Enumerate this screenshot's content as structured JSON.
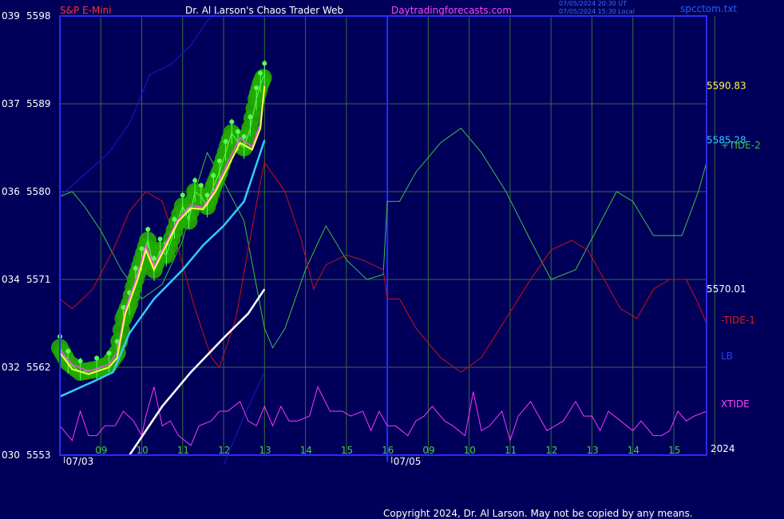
{
  "header": {
    "symbol": "S&P E-Mini",
    "title": "Dr. Al Larson's Chaos Trader Web",
    "site": "Daytradingforecasts.com",
    "timestamp_ut": "07/05/2024 20:30 UT",
    "timestamp_local": "07/05/2024 15:30 Local",
    "file": "spcctom.txt"
  },
  "footer": {
    "copyright": "Copyright 2024, Dr. Al Larson. May not be copied by any means."
  },
  "colors": {
    "background": "#00005a",
    "frame": "#2a2aff",
    "grid": "#3a6b3a",
    "tide1": "#cc1111",
    "tide2": "#3fbf3f",
    "xtide": "#ff33ff",
    "lb": "#1a1acc",
    "price_glow": "#22aa00",
    "price_bars": "#55ff55",
    "avg_yellow": "#ffff44",
    "avg_magenta": "#ff44ff",
    "cyan_line": "#33ccff",
    "white_line": "#ffffff"
  },
  "chart_data": {
    "type": "line",
    "title": "S&P E-Mini",
    "y_axis": {
      "range": [
        5553,
        5598
      ],
      "ticks": [
        5553,
        5562,
        5571,
        5580,
        5589,
        5598
      ],
      "left_codes": [
        "030",
        "032",
        "034",
        "036",
        "037",
        "039"
      ]
    },
    "x_axis": {
      "hour_ticks": [
        {
          "x": 9,
          "label": "09"
        },
        {
          "x": 10,
          "label": "10"
        },
        {
          "x": 11,
          "label": "11"
        },
        {
          "x": 12,
          "label": "12"
        },
        {
          "x": 13,
          "label": "13"
        },
        {
          "x": 14,
          "label": "14"
        },
        {
          "x": 15,
          "label": "15"
        },
        {
          "x": 16,
          "label": "16"
        },
        {
          "x": 17,
          "label": "09"
        },
        {
          "x": 18,
          "label": "10"
        },
        {
          "x": 19,
          "label": "11"
        },
        {
          "x": 20,
          "label": "12"
        },
        {
          "x": 21,
          "label": "13"
        },
        {
          "x": 22,
          "label": "14"
        },
        {
          "x": 23,
          "label": "15"
        },
        {
          "x": 24,
          "label": "16"
        }
      ],
      "dates": [
        {
          "x": 8.5,
          "label": "07/03"
        },
        {
          "x": 16.5,
          "label": "07/05"
        }
      ],
      "day_break_x": 16,
      "corner_label": "2024",
      "range": [
        8.0,
        23.8
      ]
    },
    "right_values": [
      {
        "label": "5590.83",
        "y": 5590.83,
        "color": "#ffff44"
      },
      {
        "label": "5585.28",
        "y": 5585.28,
        "color": "#33ccff"
      },
      {
        "label": "5570.01",
        "y": 5570.01,
        "color": "#ffffff"
      }
    ],
    "legend": [
      {
        "name": "+TIDE-2",
        "color": "#3fbf3f"
      },
      {
        "name": "-TIDE-1",
        "color": "#cc1111"
      },
      {
        "name": "LB",
        "color": "#1a1acc"
      },
      {
        "name": "XTIDE",
        "color": "#ff33ff"
      }
    ],
    "series": [
      {
        "name": "+TIDE-2",
        "values": [
          [
            8.0,
            5579.5
          ],
          [
            8.3,
            5580
          ],
          [
            8.6,
            5578.5
          ],
          [
            9.0,
            5576
          ],
          [
            9.5,
            5572
          ],
          [
            10.0,
            5569
          ],
          [
            10.5,
            5570.5
          ],
          [
            11.0,
            5575
          ],
          [
            11.3,
            5580
          ],
          [
            11.6,
            5584
          ],
          [
            12.0,
            5581
          ],
          [
            12.5,
            5577
          ],
          [
            13.0,
            5566
          ],
          [
            13.2,
            5564
          ],
          [
            13.5,
            5566
          ],
          [
            14.0,
            5572
          ],
          [
            14.5,
            5576.5
          ],
          [
            15.0,
            5573
          ],
          [
            15.5,
            5571
          ],
          [
            15.9,
            5571.5
          ],
          [
            16.0,
            5579
          ],
          [
            16.3,
            5579
          ],
          [
            16.7,
            5582
          ],
          [
            17.3,
            5585
          ],
          [
            17.8,
            5586.5
          ],
          [
            18.3,
            5584
          ],
          [
            18.9,
            5580
          ],
          [
            19.5,
            5575
          ],
          [
            20.0,
            5571
          ],
          [
            20.6,
            5572
          ],
          [
            21.1,
            5576
          ],
          [
            21.6,
            5580
          ],
          [
            22.0,
            5579
          ],
          [
            22.5,
            5575.5
          ],
          [
            23.2,
            5575.5
          ],
          [
            23.6,
            5580
          ],
          [
            23.8,
            5583
          ]
        ]
      },
      {
        "name": "-TIDE-1",
        "values": [
          [
            8.0,
            5569
          ],
          [
            8.3,
            5568
          ],
          [
            8.8,
            5570
          ],
          [
            9.3,
            5574
          ],
          [
            9.7,
            5578
          ],
          [
            10.1,
            5580
          ],
          [
            10.5,
            5579
          ],
          [
            10.9,
            5574
          ],
          [
            11.3,
            5568
          ],
          [
            11.7,
            5563
          ],
          [
            11.9,
            5562
          ],
          [
            12.3,
            5567
          ],
          [
            12.6,
            5574
          ],
          [
            12.9,
            5581
          ],
          [
            13.0,
            5583
          ],
          [
            13.5,
            5580
          ],
          [
            13.9,
            5575
          ],
          [
            14.2,
            5570
          ],
          [
            14.5,
            5572.5
          ],
          [
            15.0,
            5573.5
          ],
          [
            15.4,
            5573
          ],
          [
            15.9,
            5572
          ],
          [
            16.0,
            5569
          ],
          [
            16.3,
            5569
          ],
          [
            16.7,
            5566
          ],
          [
            17.3,
            5563
          ],
          [
            17.8,
            5561.5
          ],
          [
            18.3,
            5563
          ],
          [
            18.9,
            5567
          ],
          [
            19.5,
            5571
          ],
          [
            20.0,
            5574
          ],
          [
            20.5,
            5575
          ],
          [
            20.9,
            5574
          ],
          [
            21.3,
            5571
          ],
          [
            21.7,
            5568
          ],
          [
            22.1,
            5567
          ],
          [
            22.5,
            5570
          ],
          [
            22.9,
            5571
          ],
          [
            23.3,
            5571
          ],
          [
            23.6,
            5568.5
          ],
          [
            23.8,
            5566.5
          ]
        ]
      },
      {
        "name": "LB",
        "values": [
          [
            8.0,
            5579.5
          ],
          [
            9.2,
            5584
          ],
          [
            9.7,
            5587
          ],
          [
            10.2,
            5592
          ],
          [
            10.7,
            5593
          ],
          [
            11.2,
            5595
          ],
          [
            11.6,
            5597.5
          ],
          [
            11.9,
            5598.5
          ]
        ]
      },
      {
        "name": "LB (lower)",
        "values": [
          [
            12.0,
            5552
          ],
          [
            12.5,
            5557
          ],
          [
            13.0,
            5561.5
          ]
        ]
      },
      {
        "name": "White trend",
        "values": [
          [
            9.7,
            5553
          ],
          [
            10.5,
            5558
          ],
          [
            11.2,
            5561.5
          ],
          [
            12.0,
            5565
          ],
          [
            12.6,
            5567.5
          ],
          [
            13.0,
            5570
          ]
        ]
      },
      {
        "name": "Cyan line",
        "values": [
          [
            8.0,
            5559
          ],
          [
            8.8,
            5560.5
          ],
          [
            9.3,
            5561.5
          ],
          [
            9.7,
            5565.5
          ],
          [
            10.3,
            5569
          ],
          [
            11.0,
            5572
          ],
          [
            11.5,
            5574.5
          ],
          [
            12.0,
            5576.5
          ],
          [
            12.5,
            5579
          ],
          [
            13.0,
            5585.28
          ]
        ]
      },
      {
        "name": "Yellow average",
        "values": [
          [
            8.0,
            5563.5
          ],
          [
            8.3,
            5561.8
          ],
          [
            8.7,
            5561.3
          ],
          [
            9.2,
            5562
          ],
          [
            9.4,
            5563
          ],
          [
            9.6,
            5567.5
          ],
          [
            9.9,
            5571
          ],
          [
            10.1,
            5574
          ],
          [
            10.3,
            5572
          ],
          [
            10.6,
            5574.5
          ],
          [
            10.9,
            5577
          ],
          [
            11.2,
            5578.3
          ],
          [
            11.5,
            5578.2
          ],
          [
            11.8,
            5580
          ],
          [
            12.1,
            5582.5
          ],
          [
            12.4,
            5585
          ],
          [
            12.7,
            5584.3
          ],
          [
            12.9,
            5586.5
          ],
          [
            13.0,
            5590.83
          ]
        ]
      },
      {
        "name": "Magenta average",
        "values": [
          [
            8.0,
            5563.8
          ],
          [
            8.3,
            5562.3
          ],
          [
            8.7,
            5561.6
          ],
          [
            9.2,
            5562.3
          ],
          [
            9.4,
            5563.5
          ],
          [
            9.6,
            5568
          ],
          [
            9.9,
            5571.5
          ],
          [
            10.1,
            5574.5
          ],
          [
            10.3,
            5572.3
          ],
          [
            10.6,
            5574.8
          ],
          [
            10.9,
            5577.3
          ],
          [
            11.2,
            5578.6
          ],
          [
            11.5,
            5578.4
          ],
          [
            11.8,
            5580.3
          ],
          [
            12.1,
            5583
          ],
          [
            12.4,
            5585.5
          ],
          [
            12.7,
            5584.6
          ],
          [
            12.9,
            5587
          ],
          [
            13.0,
            5591
          ]
        ]
      },
      {
        "name": "Price",
        "values": [
          [
            8.0,
            5564
          ],
          [
            8.2,
            5562.5
          ],
          [
            8.5,
            5561.5
          ],
          [
            8.9,
            5561.8
          ],
          [
            9.2,
            5562.3
          ],
          [
            9.4,
            5563.5
          ],
          [
            9.55,
            5567
          ],
          [
            9.7,
            5568.5
          ],
          [
            9.85,
            5571
          ],
          [
            10.0,
            5573
          ],
          [
            10.15,
            5575
          ],
          [
            10.3,
            5572
          ],
          [
            10.45,
            5574
          ],
          [
            10.6,
            5573.5
          ],
          [
            10.8,
            5576
          ],
          [
            11.0,
            5578.5
          ],
          [
            11.15,
            5577
          ],
          [
            11.3,
            5580
          ],
          [
            11.45,
            5579.5
          ],
          [
            11.6,
            5578.5
          ],
          [
            11.75,
            5580.5
          ],
          [
            11.9,
            5582
          ],
          [
            12.05,
            5584
          ],
          [
            12.2,
            5586
          ],
          [
            12.35,
            5585
          ],
          [
            12.5,
            5584.5
          ],
          [
            12.65,
            5586.5
          ],
          [
            12.8,
            5589.5
          ],
          [
            12.9,
            5591
          ],
          [
            13.0,
            5592
          ]
        ]
      },
      {
        "name": "XTIDE",
        "values": [
          [
            8.0,
            5556
          ],
          [
            8.3,
            5554.5
          ],
          [
            8.5,
            5557.5
          ],
          [
            8.7,
            5555
          ],
          [
            8.9,
            5555
          ],
          [
            9.1,
            5556
          ],
          [
            9.35,
            5556
          ],
          [
            9.55,
            5557.5
          ],
          [
            9.8,
            5556.5
          ],
          [
            10.0,
            5555
          ],
          [
            10.1,
            5557
          ],
          [
            10.3,
            5560
          ],
          [
            10.5,
            5556
          ],
          [
            10.7,
            5556.5
          ],
          [
            10.9,
            5555
          ],
          [
            11.2,
            5554
          ],
          [
            11.4,
            5556
          ],
          [
            11.7,
            5556.5
          ],
          [
            11.9,
            5557.5
          ],
          [
            12.1,
            5557.5
          ],
          [
            12.4,
            5558.5
          ],
          [
            12.6,
            5556.5
          ],
          [
            12.8,
            5556
          ],
          [
            13.0,
            5558
          ],
          [
            13.2,
            5556
          ],
          [
            13.4,
            5558
          ],
          [
            13.6,
            5556.5
          ],
          [
            13.8,
            5556.5
          ],
          [
            14.1,
            5557
          ],
          [
            14.3,
            5560
          ],
          [
            14.6,
            5557.5
          ],
          [
            14.9,
            5557.5
          ],
          [
            15.1,
            5557
          ],
          [
            15.4,
            5557.5
          ],
          [
            15.6,
            5555.5
          ],
          [
            15.8,
            5557.5
          ],
          [
            16.0,
            5556
          ],
          [
            16.2,
            5556
          ],
          [
            16.5,
            5555
          ],
          [
            16.7,
            5556.5
          ],
          [
            16.9,
            5557
          ],
          [
            17.1,
            5558
          ],
          [
            17.4,
            5556.5
          ],
          [
            17.6,
            5556
          ],
          [
            17.9,
            5555
          ],
          [
            18.1,
            5559.5
          ],
          [
            18.3,
            5555.5
          ],
          [
            18.5,
            5556
          ],
          [
            18.8,
            5557.5
          ],
          [
            19.0,
            5554.5
          ],
          [
            19.2,
            5557
          ],
          [
            19.5,
            5558.5
          ],
          [
            19.7,
            5557
          ],
          [
            19.9,
            5555.5
          ],
          [
            20.1,
            5556
          ],
          [
            20.3,
            5556.5
          ],
          [
            20.6,
            5558.5
          ],
          [
            20.8,
            5557
          ],
          [
            21.0,
            5557
          ],
          [
            21.2,
            5555.5
          ],
          [
            21.4,
            5557.5
          ],
          [
            21.7,
            5556.5
          ],
          [
            22.0,
            5555.5
          ],
          [
            22.2,
            5556.5
          ],
          [
            22.5,
            5555
          ],
          [
            22.7,
            5555
          ],
          [
            22.9,
            5555.5
          ],
          [
            23.1,
            5557.5
          ],
          [
            23.3,
            5556.5
          ],
          [
            23.5,
            5557
          ],
          [
            23.8,
            5557.5
          ]
        ]
      }
    ]
  }
}
